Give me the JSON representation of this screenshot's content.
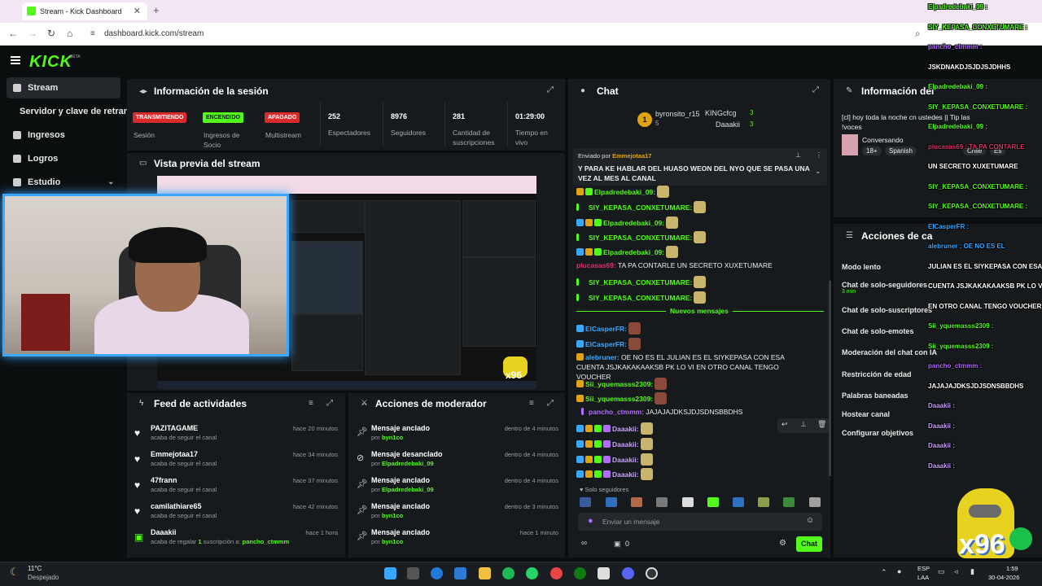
{
  "browser": {
    "tab_title": "Stream - Kick Dashboard",
    "url": "dashboard.kick.com/stream"
  },
  "logo": {
    "text": "KICK",
    "beta": "BETA"
  },
  "sidebar": {
    "items": [
      {
        "label": "Stream"
      },
      {
        "label": "Servidor y clave de retransm"
      },
      {
        "label": "Ingresos"
      },
      {
        "label": "Logros"
      },
      {
        "label": "Estudio"
      }
    ]
  },
  "session": {
    "title": "Información de la sesión",
    "badges": [
      {
        "text": "TRANSMITIENDO",
        "label": "Sesión",
        "color": "#d92b2b"
      },
      {
        "text": "ENCENDIDO",
        "label": "Ingresos de Socio",
        "color": "#53fc18"
      },
      {
        "text": "APAGADO",
        "label": "Multistream",
        "color": "#d92b2b"
      }
    ],
    "stats": [
      {
        "value": "252",
        "label": "Espectadores"
      },
      {
        "value": "8976",
        "label": "Seguidores"
      },
      {
        "value": "281",
        "label": "Cantidad de suscripciones"
      },
      {
        "value": "01:29:00",
        "label": "Tiempo en vivo"
      }
    ]
  },
  "preview": {
    "title": "Vista previa del stream",
    "x96": "x96"
  },
  "feed": {
    "title": "Feed de actividades",
    "items": [
      {
        "name": "PAZITAGAME",
        "sub": "acaba de seguir el canal",
        "time": "hace 20 minutos"
      },
      {
        "name": "Emmejotaa17",
        "sub": "acaba de seguir el canal",
        "time": "hace 34 minutos"
      },
      {
        "name": "47frann",
        "sub": "acaba de seguir el canal",
        "time": "hace 37 minutos"
      },
      {
        "name": "camilathiare65",
        "sub": "acaba de seguir el canal",
        "time": "hace 42 minutos"
      },
      {
        "name": "Daaakii",
        "sub_pre": "acaba de regalar",
        "sub_num": "1",
        "sub_mid": "suscripción a:",
        "sub_user": "pancho_ctmmm",
        "time": "hace 1 hora"
      }
    ]
  },
  "mod_actions": {
    "title": "Acciones de moderador",
    "items": [
      {
        "action": "Mensaje anclado",
        "by": "por",
        "user": "byn1co",
        "time": "dentro de 4 minutos"
      },
      {
        "action": "Mensaje desanclado",
        "by": "por",
        "user": "Elpadredebaki_09",
        "time": "dentro de 4 minutos"
      },
      {
        "action": "Mensaje anclado",
        "by": "por",
        "user": "Elpadredebaki_09",
        "time": "dentro de 4 minutos"
      },
      {
        "action": "Mensaje anclado",
        "by": "por",
        "user": "byn1co",
        "time": "dentro de 3 minutos"
      },
      {
        "action": "Mensaje anclado",
        "by": "por",
        "user": "byn1co",
        "time": "hace 1 minuto"
      }
    ]
  },
  "chat": {
    "title": "Chat",
    "top_gifters": [
      {
        "name": "byronsito_r15",
        "count": "5"
      },
      {
        "name": "KINGcfcg",
        "count": "3"
      },
      {
        "name": "Daaakii",
        "count": "3"
      }
    ],
    "gifter_rank": "1",
    "pinned": {
      "by_label": "Enviado por",
      "by_user": "Emmejotaa17",
      "text": "Y PARA KE HABLAR DEL HUASO WEON DEL NYO QUE SE PASA UNA VEZ AL MES AL CANAL"
    },
    "messages": [
      {
        "user": "Elpadredebaki_09:",
        "text": "",
        "color": "#53fc18"
      },
      {
        "user": "SIY_KEPASA_CONXETUMARE:",
        "text": "",
        "color": "#53fc18"
      },
      {
        "user": "Elpadredebaki_09:",
        "text": "",
        "color": "#53fc18"
      },
      {
        "user": "SIY_KEPASA_CONXETUMARE:",
        "text": "",
        "color": "#53fc18"
      },
      {
        "user": "Elpadredebaki_09:",
        "text": "",
        "color": "#53fc18"
      },
      {
        "user": "plucasas69:",
        "text": "TA PA CONTARLE UN SECRETO XUXETUMARE",
        "color": "#e0306b"
      },
      {
        "user": "SIY_KEPASA_CONXETUMARE:",
        "text": "",
        "color": "#53fc18"
      },
      {
        "user": "SIY_KEPASA_CONXETUMARE:",
        "text": "",
        "color": "#53fc18"
      }
    ],
    "new_messages_label": "Nuevos mensajes",
    "messages2": [
      {
        "user": "ElCasperFR:",
        "text": "",
        "color": "#3aa8ff"
      },
      {
        "user": "ElCasperFR:",
        "text": "",
        "color": "#3aa8ff"
      },
      {
        "user": "alebruner:",
        "text": "OE NO ES EL JULIAN ES EL SIYKEPASA CON ESA CUENTA JSJKAKAKAAKSB PK LO VI EN OTRO CANAL TENGO VOUCHER",
        "color": "#3aa8ff"
      },
      {
        "user": "Sii_yquemasss2309:",
        "text": "",
        "color": "#53fc18"
      },
      {
        "user": "Sii_yquemasss2309:",
        "text": "",
        "color": "#53fc18"
      },
      {
        "user": "pancho_ctmmm:",
        "text": "JAJAJAJDKSJDJSDNSBBDHS",
        "color": "#b36bff"
      },
      {
        "user": "Daaakii:",
        "text": "",
        "color": "#c9a0ff"
      },
      {
        "user": "Daaakii:",
        "text": "",
        "color": "#c9a0ff"
      },
      {
        "user": "Daaakii:",
        "text": "",
        "color": "#c9a0ff"
      },
      {
        "user": "Daaakii:",
        "text": "",
        "color": "#c9a0ff"
      }
    ],
    "followers_only": "Solo seguidores",
    "input_placeholder": "Enviar un mensaje",
    "points": "0",
    "send_button": "Chat"
  },
  "right": {
    "info_title": "Información del",
    "stream_title": "[cl] hoy toda la noche cn ustedes || Tip las !voces",
    "category": "Conversando",
    "tags": [
      "18+",
      "Spanish",
      "Chile",
      "Es"
    ],
    "actions_title": "Acciones de ca",
    "actions": [
      {
        "label": "Modo lento"
      },
      {
        "label": "Chat de solo-seguidores",
        "sub": "3 min"
      },
      {
        "label": "Chat de solo-suscriptores"
      },
      {
        "label": "Chat de solo-emotes"
      },
      {
        "label": "Moderación del chat con IA"
      },
      {
        "label": "Restricción de edad"
      },
      {
        "label": "Palabras baneadas"
      },
      {
        "label": "Hostear canal"
      },
      {
        "label": "Configurar objetivos"
      }
    ]
  },
  "overlay_chat": [
    {
      "user": "Elpadredebaki_09 :",
      "color": "#53fc18"
    },
    {
      "user": "SIY_KEPASA_CONXETUMARE :",
      "color": "#53fc18"
    },
    {
      "user": "pancho_ctmmm :",
      "color": "#b36bff"
    },
    {
      "user": "JSKDNAKDJSJDJSJDHHS",
      "color": "#ffffff"
    },
    {
      "user": "Elpadredebaki_09 :",
      "color": "#53fc18"
    },
    {
      "user": "SIY_KEPASA_CONXETUMARE :",
      "color": "#53fc18"
    },
    {
      "user": "Elpadredebaki_09 :",
      "color": "#53fc18"
    },
    {
      "user": "plucasas69 : TA PA CONTARLE",
      "color": "#e0306b"
    },
    {
      "user": "UN SECRETO XUXETUMARE",
      "color": "#ffffff"
    },
    {
      "user": "SIY_KEPASA_CONXETUMARE :",
      "color": "#53fc18"
    },
    {
      "user": "SIY_KEPASA_CONXETUMARE :",
      "color": "#53fc18"
    },
    {
      "user": "ElCasperFR :",
      "color": "#3aa8ff"
    },
    {
      "user": "alebruner : OE NO ES EL",
      "color": "#3aa8ff"
    },
    {
      "user": "JULIAN ES EL SIYKEPASA CON ESA",
      "color": "#ffffff"
    },
    {
      "user": "CUENTA JSJKAKAKAAKSB PK LO VI",
      "color": "#ffffff"
    },
    {
      "user": "EN OTRO CANAL TENGO VOUCHER",
      "color": "#ffffff"
    },
    {
      "user": "Sii_yquemasss2309 :",
      "color": "#53fc18"
    },
    {
      "user": "Sii_yquemasss2309 :",
      "color": "#53fc18"
    },
    {
      "user": "pancho_ctmmm :",
      "color": "#b36bff"
    },
    {
      "user": "JAJAJAJDKSJDJSDNSBBDHS",
      "color": "#ffffff"
    },
    {
      "user": "Daaakii :",
      "color": "#c9a0ff"
    },
    {
      "user": "Daaakii :",
      "color": "#c9a0ff"
    },
    {
      "user": "Daaakii :",
      "color": "#c9a0ff"
    },
    {
      "user": "Daaakii :",
      "color": "#c9a0ff"
    }
  ],
  "overlay_x96": "x96",
  "taskbar": {
    "weather_temp": "11°C",
    "weather_desc": "Despejado",
    "lang": "ESP",
    "lang2": "LAA",
    "time": "1:59",
    "date": "30-04-2026"
  }
}
